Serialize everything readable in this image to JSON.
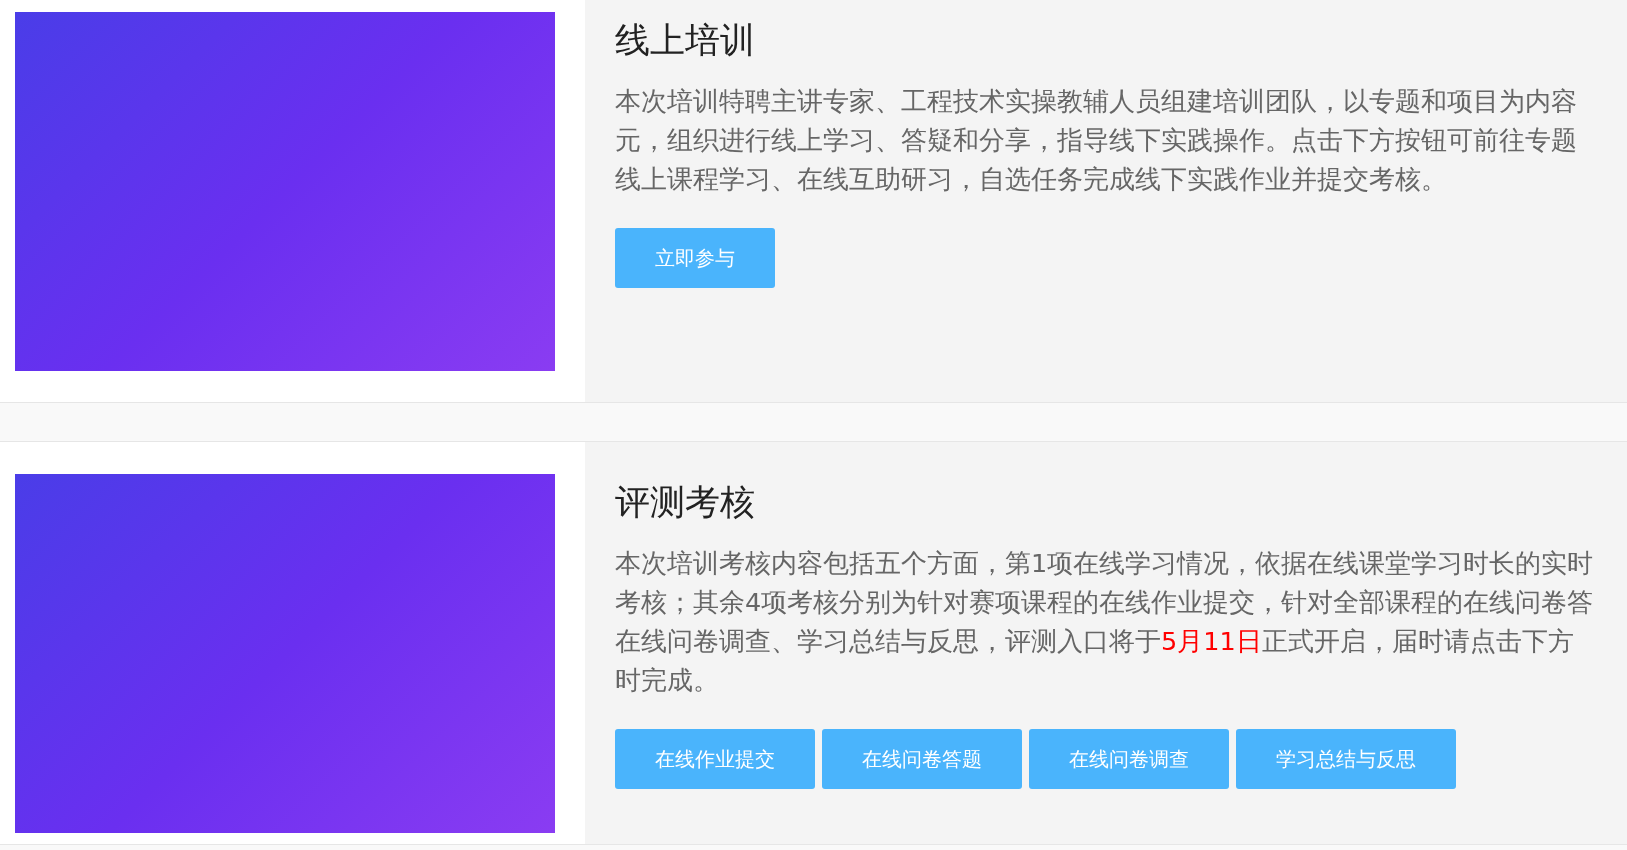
{
  "sections": [
    {
      "title": "线上培训",
      "lines": [
        [
          {
            "text": "本次培训特聘主讲专家、工程技术实操教辅人员组建培训团队，以专题和项目为内容",
            "highlight": false
          }
        ],
        [
          {
            "text": "元，组织进行线上学习、答疑和分享，指导线下实践操作。点击下方按钮可前往专题",
            "highlight": false
          }
        ],
        [
          {
            "text": "线上课程学习、在线互助研习，自选任务完成线下实践作业并提交考核。",
            "highlight": false
          }
        ]
      ],
      "buttons": [
        "立即参与"
      ]
    },
    {
      "title": "评测考核",
      "lines": [
        [
          {
            "text": "本次培训考核内容包括五个方面，第1项在线学习情况，依据在线课堂学习时长的实时",
            "highlight": false
          }
        ],
        [
          {
            "text": "考核；其余4项考核分别为针对赛项课程的在线作业提交，针对全部课程的在线问卷答",
            "highlight": false
          }
        ],
        [
          {
            "text": "在线问卷调查、学习总结与反思，评测入口将于",
            "highlight": false
          },
          {
            "text": "5月11日",
            "highlight": true
          },
          {
            "text": "正式开启，届时请点击下方",
            "highlight": false
          }
        ],
        [
          {
            "text": "时完成。",
            "highlight": false
          }
        ]
      ],
      "buttons": [
        "在线作业提交",
        "在线问卷答题",
        "在线问卷调查",
        "学习总结与反思"
      ]
    }
  ]
}
